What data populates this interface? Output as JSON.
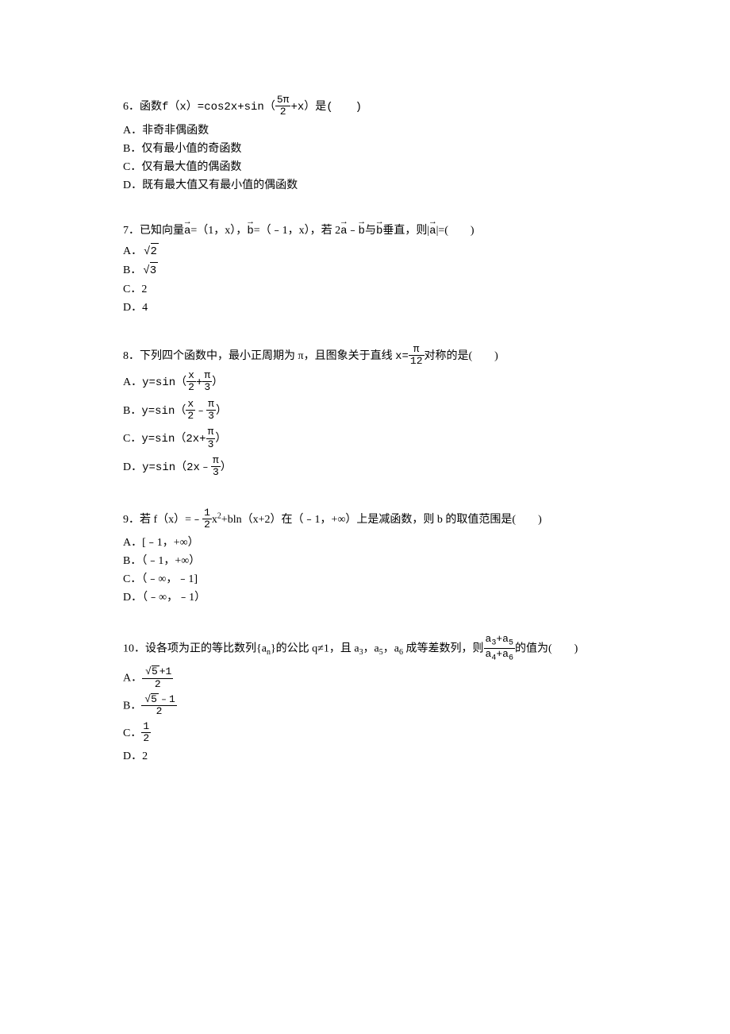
{
  "q6": {
    "num": "6．",
    "stem_a": "函数",
    "stem_b": "f（x）=cos2x+sin（",
    "frac_num": "5π",
    "frac_den": "2",
    "stem_c": "+x）是(　　)",
    "A": "A．非奇非偶函数",
    "B": "B．仅有最小值的奇函数",
    "C": "C．仅有最大值的偶函数",
    "D": "D．既有最大值又有最小值的偶函数"
  },
  "q7": {
    "num": "7．",
    "stem_a": "已知向量",
    "vec_a": "a",
    "stem_b": "=（1，x），",
    "vec_b": "b",
    "stem_c": "=（﹣1，x），若 2",
    "stem_d": "﹣",
    "stem_e": "与",
    "stem_f": "垂直，则|",
    "stem_g": "|=(　　)",
    "A_pre": "A．",
    "A_rad": "2",
    "B_pre": "B．",
    "B_rad": "3",
    "C": "C．2",
    "D": "D．4"
  },
  "q8": {
    "num": "8．",
    "stem_a": "下列四个函数中，最小正周期为 π，且图象关于直线 ",
    "x_eq": "x=",
    "frac_num": "π",
    "frac_den": "12",
    "stem_b": "对称的是(　　)",
    "A_pre": "A．",
    "A_main": "y=sin（",
    "A_n1": "x",
    "A_d1": "2",
    "A_plus": "+",
    "A_n2": "π",
    "A_d2": "3",
    "A_end": "）",
    "B_pre": "B．",
    "B_main": "y=sin（",
    "B_n1": "x",
    "B_d1": "2",
    "B_minus": "﹣",
    "B_n2": "π",
    "B_d2": "3",
    "B_end": "）",
    "C_pre": "C．",
    "C_main": "y=sin（2x+",
    "C_n": "π",
    "C_d": "3",
    "C_end": "）",
    "D_pre": "D．",
    "D_main": "y=sin（2x﹣",
    "D_n": "π",
    "D_d": "3",
    "D_end": "）"
  },
  "q9": {
    "num": "9．",
    "stem_a": "若 f（x）=﹣",
    "frac_num": "1",
    "frac_den": "2",
    "stem_b": "x",
    "sup": "2",
    "stem_c": "+bln（x+2）在（﹣1，+∞）上是减函数，则 b 的取值范围是(　　)",
    "A": "A．[﹣1，+∞）",
    "B": "B．（﹣1，+∞）",
    "C": "C．（﹣∞，﹣1]",
    "D": "D．（﹣∞，﹣1）"
  },
  "q10": {
    "num": "10．",
    "stem_a": "设各项为正的等比数列{a",
    "sub_n": "n",
    "stem_b": "}的公比 q≠1，且 a",
    "sub_3": "3",
    "stem_c": "，a",
    "sub_5": "5",
    "stem_d": "，a",
    "sub_6": "6",
    "stem_e": " 成等差数列，则",
    "f_num_a": "a",
    "f_num_3": "3",
    "f_num_plus": "+a",
    "f_num_5": "5",
    "f_den_a": "a",
    "f_den_4": "4",
    "f_den_plus": "+a",
    "f_den_6": "6",
    "stem_f": "的值为(　　)",
    "A_pre": "A．",
    "A_num_r": "5",
    "A_num_p": "+1",
    "A_den": "2",
    "B_pre": "B．",
    "B_num_r": "5",
    "B_num_m": "﹣1",
    "B_den": "2",
    "C_pre": "C．",
    "C_num": "1",
    "C_den": "2",
    "D": "D．2"
  },
  "chart_data": null
}
